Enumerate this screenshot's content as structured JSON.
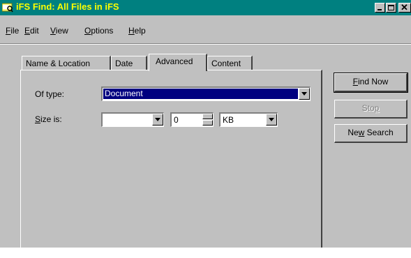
{
  "window": {
    "title": "iFS Find: All Files in iFS"
  },
  "menu": [
    {
      "label": "File",
      "accel": "F"
    },
    {
      "label": "Edit",
      "accel": "E"
    },
    {
      "label": "View",
      "accel": "V"
    },
    {
      "label": "Options",
      "accel": "O"
    },
    {
      "label": "Help",
      "accel": "H"
    }
  ],
  "tabs": [
    {
      "label": "Name & Location",
      "active": false
    },
    {
      "label": "Date",
      "active": false
    },
    {
      "label": "Advanced",
      "active": true
    },
    {
      "label": "Content",
      "active": false
    }
  ],
  "advanced": {
    "of_type_label": "Of type:",
    "of_type_value": "Document",
    "size_label": "Size is:",
    "size_condition": "",
    "size_number": "0",
    "size_unit": "KB"
  },
  "buttons": {
    "find_now": "Find Now",
    "stop": "Stop",
    "new_search": "New Search"
  },
  "colors": {
    "titlebar": "#008080",
    "title_text": "#ffff00",
    "selection": "#000080",
    "face": "#c0c0c0"
  }
}
